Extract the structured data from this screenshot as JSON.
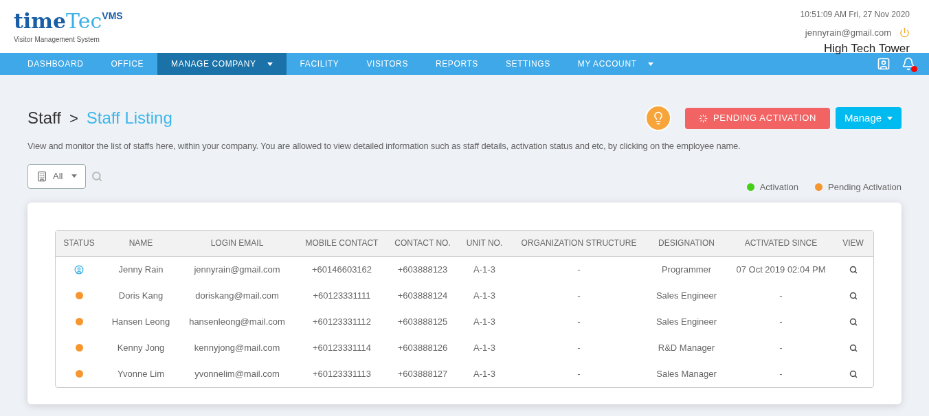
{
  "logo": {
    "wordmark_left": "time",
    "wordmark_right": "Tec",
    "badge": "VMS",
    "tagline": "Visitor Management System"
  },
  "header": {
    "datetime": "10:51:09 AM  Fri, 27 Nov 2020",
    "email": "jennyrain@gmail.com",
    "site": "High Tech Tower"
  },
  "nav": [
    {
      "label": "DASHBOARD",
      "selected": false,
      "dropdown": false
    },
    {
      "label": "OFFICE",
      "selected": false,
      "dropdown": false
    },
    {
      "label": "MANAGE COMPANY",
      "selected": true,
      "dropdown": true
    },
    {
      "label": "FACILITY",
      "selected": false,
      "dropdown": false
    },
    {
      "label": "VISITORS",
      "selected": false,
      "dropdown": false
    },
    {
      "label": "REPORTS",
      "selected": false,
      "dropdown": false
    },
    {
      "label": "SETTINGS",
      "selected": false,
      "dropdown": false
    },
    {
      "label": "MY ACCOUNT",
      "selected": false,
      "dropdown": true
    }
  ],
  "breadcrumb": {
    "parent": "Staff",
    "separator": ">",
    "current": "Staff Listing"
  },
  "actions": {
    "pending_button": "PENDING ACTIVATION",
    "manage_button": "Manage"
  },
  "description": "View and monitor the list of staffs here, within your company. You are allowed to view detailed information such as staff details, activation status and etc, by clicking on the employee name.",
  "filter": {
    "value": "All"
  },
  "legend": [
    {
      "label": "Activation",
      "color": "#44d016"
    },
    {
      "label": "Pending Activation",
      "color": "#f7962e"
    }
  ],
  "table": {
    "columns": [
      "STATUS",
      "NAME",
      "LOGIN EMAIL",
      "MOBILE CONTACT",
      "CONTACT NO.",
      "UNIT NO.",
      "ORGANIZATION STRUCTURE",
      "DESIGNATION",
      "ACTIVATED SINCE",
      "VIEW"
    ],
    "rows": [
      {
        "status": {
          "kind": "user",
          "color": "#1ea7e8"
        },
        "name": "Jenny Rain",
        "login_email": "jennyrain@gmail.com",
        "mobile_contact": "+60146603162",
        "contact_no": "+603888123",
        "unit_no": "A-1-3",
        "organization_structure": "-",
        "designation": "Programmer",
        "activated_since": "07 Oct 2019 02:04 PM"
      },
      {
        "status": {
          "kind": "dot",
          "color": "#f7962e"
        },
        "name": "Doris Kang",
        "login_email": "doriskang@mail.com",
        "mobile_contact": "+60123331111",
        "contact_no": "+603888124",
        "unit_no": "A-1-3",
        "organization_structure": "-",
        "designation": "Sales Engineer",
        "activated_since": "-"
      },
      {
        "status": {
          "kind": "dot",
          "color": "#f7962e"
        },
        "name": "Hansen Leong",
        "login_email": "hansenleong@mail.com",
        "mobile_contact": "+60123331112",
        "contact_no": "+603888125",
        "unit_no": "A-1-3",
        "organization_structure": "-",
        "designation": "Sales Engineer",
        "activated_since": "-"
      },
      {
        "status": {
          "kind": "dot",
          "color": "#f7962e"
        },
        "name": "Kenny Jong",
        "login_email": "kennyjong@mail.com",
        "mobile_contact": "+60123331114",
        "contact_no": "+603888126",
        "unit_no": "A-1-3",
        "organization_structure": "-",
        "designation": "R&D Manager",
        "activated_since": "-"
      },
      {
        "status": {
          "kind": "dot",
          "color": "#f7962e"
        },
        "name": "Yvonne Lim",
        "login_email": "yvonnelim@mail.com",
        "mobile_contact": "+60123331113",
        "contact_no": "+603888127",
        "unit_no": "A-1-3",
        "organization_structure": "-",
        "designation": "Sales Manager",
        "activated_since": "-"
      }
    ]
  }
}
